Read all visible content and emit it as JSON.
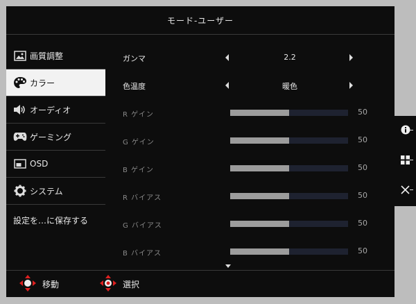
{
  "header": {
    "title": "モード-ユーザー"
  },
  "sidebar": {
    "items": [
      {
        "label": "画質調整",
        "icon": "picture-icon",
        "active": false
      },
      {
        "label": "カラー",
        "icon": "palette-icon",
        "active": true
      },
      {
        "label": "オーディオ",
        "icon": "speaker-icon",
        "active": false
      },
      {
        "label": "ゲーミング",
        "icon": "gamepad-icon",
        "active": false
      },
      {
        "label": "OSD",
        "icon": "osd-icon",
        "active": false
      },
      {
        "label": "システム",
        "icon": "gear-icon",
        "active": false
      }
    ],
    "save_label": "設定を…に保存する"
  },
  "settings": {
    "gamma": {
      "label": "ガンマ",
      "value": "2.2"
    },
    "color_temp": {
      "label": "色温度",
      "value": "暖色"
    },
    "sliders": [
      {
        "label": "R ゲイン",
        "value": "50",
        "level": 0.5
      },
      {
        "label": "G ゲイン",
        "value": "50",
        "level": 0.5
      },
      {
        "label": "B ゲイン",
        "value": "50",
        "level": 0.5
      },
      {
        "label": "R バイアス",
        "value": "50",
        "level": 0.5
      },
      {
        "label": "G バイアス",
        "value": "50",
        "level": 0.5
      },
      {
        "label": "B バイアス",
        "value": "50",
        "level": 0.5
      }
    ]
  },
  "footer": {
    "move_label": "移動",
    "select_label": "選択"
  },
  "side_panel": {
    "icons": [
      "info-icon",
      "grid-icon",
      "close-icon"
    ]
  },
  "colors": {
    "background": "#0d0d0d",
    "active_bg": "#f2f2f2",
    "slider_track": "#1e2230",
    "slider_fill": "#9c9c9c",
    "dpad_accent": "#e02020"
  }
}
